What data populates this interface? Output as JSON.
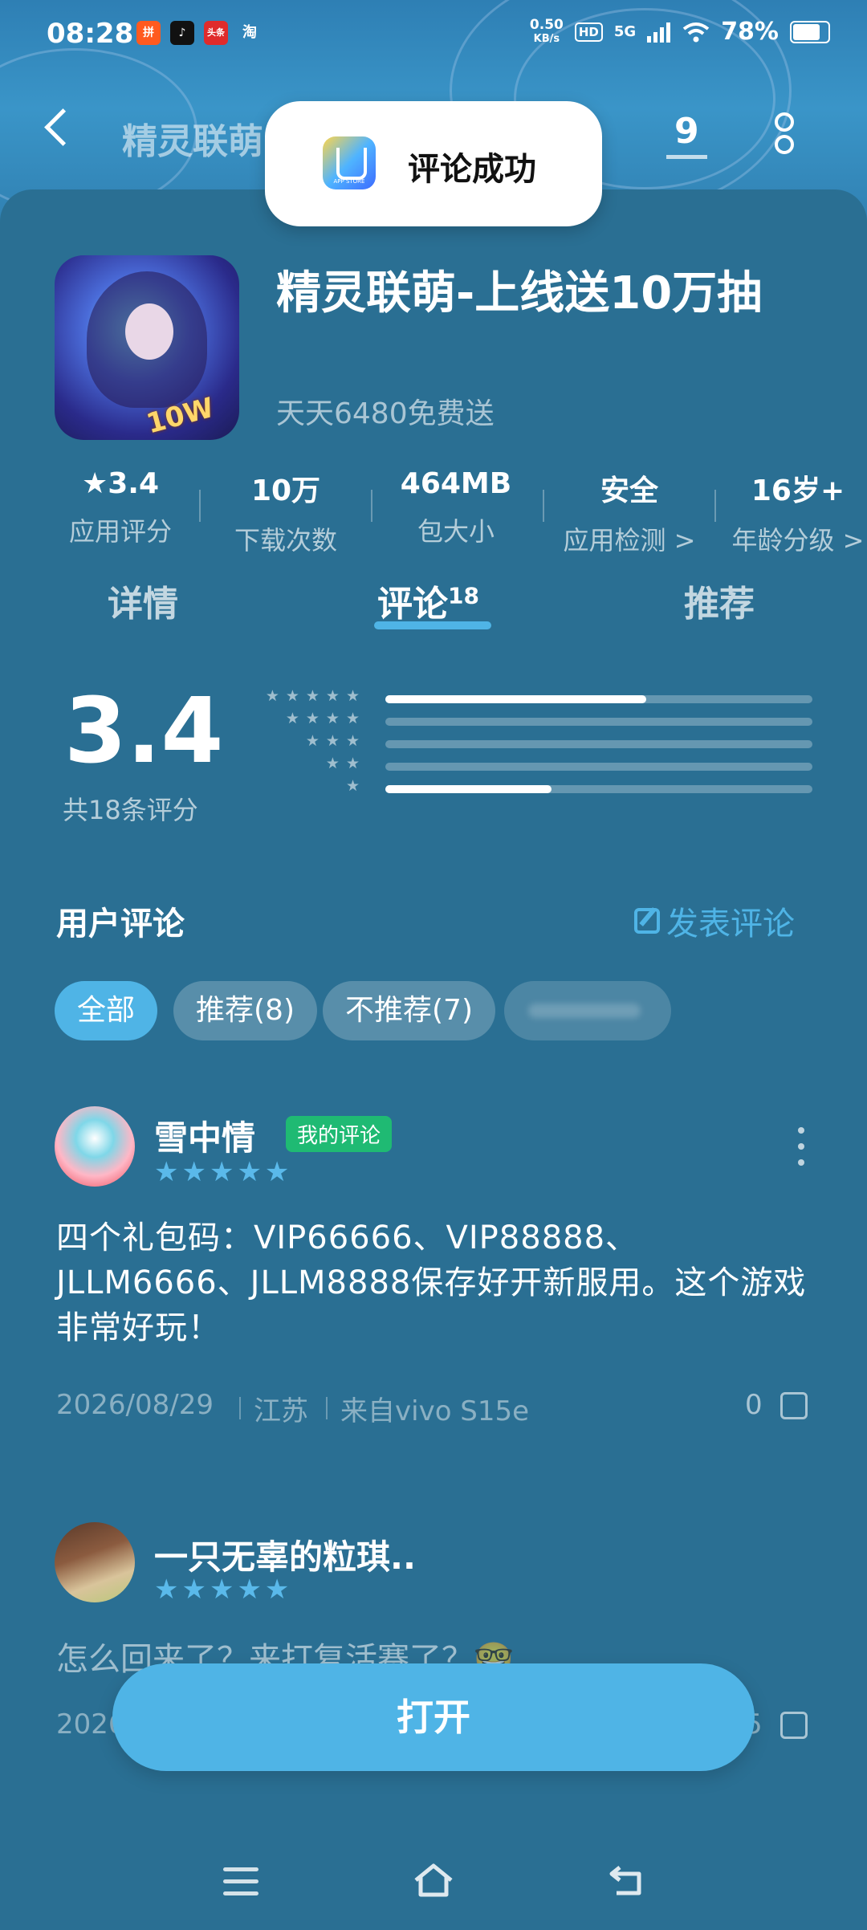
{
  "status_bar": {
    "time": "08:28",
    "net_speed": "0.50",
    "net_unit": "KB/s",
    "hd": "HD",
    "network": "5G",
    "battery": "78%",
    "app_icons": [
      "pinduoduo-icon",
      "douyin-icon",
      "toutiao-icon",
      "taobao-icon"
    ],
    "app_labels": [
      "拼",
      "♪",
      "头条",
      "淘"
    ]
  },
  "nav": {
    "title": "精灵联萌",
    "count": "9"
  },
  "toast": {
    "logo_text": "APP STORE",
    "message": "评论成功"
  },
  "app": {
    "name": "精灵联萌-上线送10万抽",
    "subtitle": "天天6480免费送",
    "icon_badge": "10W抽"
  },
  "stats": [
    {
      "value": "★3.4",
      "label": "应用评分"
    },
    {
      "value": "10万",
      "label": "下载次数"
    },
    {
      "value": "464MB",
      "label": "包大小"
    },
    {
      "value": "安全",
      "label": "应用检测 >"
    },
    {
      "value": "16岁+",
      "label": "年龄分级 >"
    }
  ],
  "tabs": {
    "details": "详情",
    "reviews": "评论",
    "reviews_count": "18",
    "recommend": "推荐"
  },
  "rating": {
    "score": "3.4",
    "total": "共18条评分",
    "distribution": [
      {
        "stars": "★★★★★",
        "fraction": 0.61
      },
      {
        "stars": "★★★★",
        "fraction": 0.0
      },
      {
        "stars": "★★★",
        "fraction": 0.0
      },
      {
        "stars": "★★",
        "fraction": 0.0
      },
      {
        "stars": "★",
        "fraction": 0.39
      }
    ]
  },
  "reviews_section": {
    "title": "用户评论",
    "write": "发表评论",
    "chips": [
      "全部",
      "推荐(8)",
      "不推荐(7)"
    ]
  },
  "reviews": [
    {
      "name": "雪中情",
      "badge": "我的评论",
      "stars": "★★★★★",
      "text": "四个礼包码：VIP66666、VIP88888、JLLM6666、JLLM8888保存好开新服用。这个游戏非常好玩！",
      "date": "2026/08/29",
      "region": "江苏",
      "device": "来自vivo S15e",
      "likes": "0"
    },
    {
      "name": "一只无辜的粒琪..",
      "stars": "★★★★★",
      "text": "怎么回来了？来打复活赛了？🤓",
      "date": "2026",
      "likes": "5"
    }
  ],
  "open_button": "打开"
}
